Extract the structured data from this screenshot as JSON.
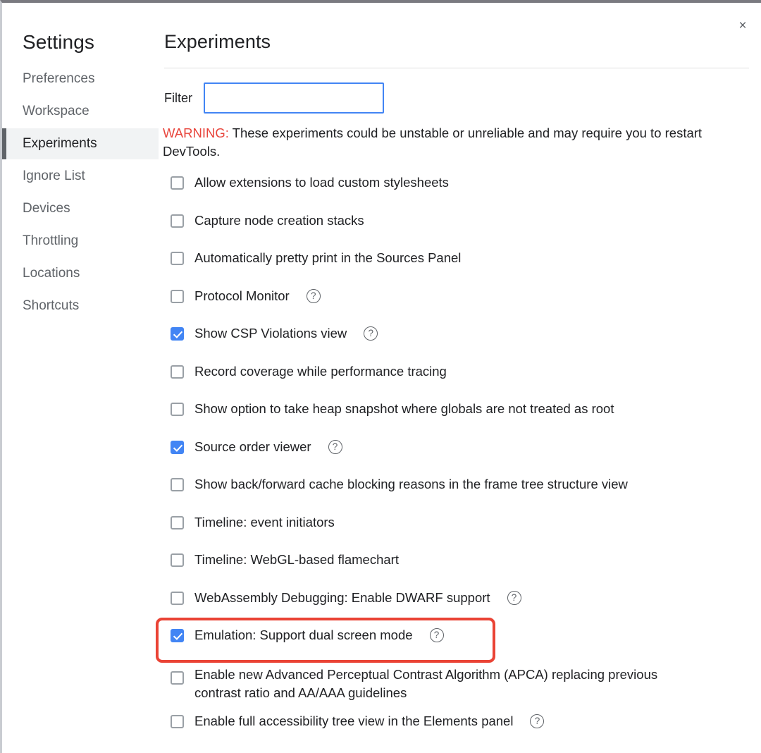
{
  "window": {
    "close_label": "×"
  },
  "sidebar": {
    "title": "Settings",
    "items": [
      {
        "label": "Preferences",
        "selected": false
      },
      {
        "label": "Workspace",
        "selected": false
      },
      {
        "label": "Experiments",
        "selected": true
      },
      {
        "label": "Ignore List",
        "selected": false
      },
      {
        "label": "Devices",
        "selected": false
      },
      {
        "label": "Throttling",
        "selected": false
      },
      {
        "label": "Locations",
        "selected": false
      },
      {
        "label": "Shortcuts",
        "selected": false
      }
    ]
  },
  "content": {
    "title": "Experiments",
    "filter": {
      "label": "Filter",
      "value": "",
      "placeholder": ""
    },
    "warning": {
      "tag": "WARNING:",
      "text": " These experiments could be unstable or unreliable and may require you to restart DevTools."
    },
    "experiments": [
      {
        "label": "Allow extensions to load custom stylesheets",
        "checked": false,
        "help": false
      },
      {
        "label": "Capture node creation stacks",
        "checked": false,
        "help": false
      },
      {
        "label": "Automatically pretty print in the Sources Panel",
        "checked": false,
        "help": false
      },
      {
        "label": "Protocol Monitor",
        "checked": false,
        "help": true
      },
      {
        "label": "Show CSP Violations view",
        "checked": true,
        "help": true
      },
      {
        "label": "Record coverage while performance tracing",
        "checked": false,
        "help": false
      },
      {
        "label": "Show option to take heap snapshot where globals are not treated as root",
        "checked": false,
        "help": false
      },
      {
        "label": "Source order viewer",
        "checked": true,
        "help": true
      },
      {
        "label": "Show back/forward cache blocking reasons in the frame tree structure view",
        "checked": false,
        "help": false
      },
      {
        "label": "Timeline: event initiators",
        "checked": false,
        "help": false
      },
      {
        "label": "Timeline: WebGL-based flamechart",
        "checked": false,
        "help": false
      },
      {
        "label": "WebAssembly Debugging: Enable DWARF support",
        "checked": false,
        "help": true
      },
      {
        "label": "Emulation: Support dual screen mode",
        "checked": true,
        "help": true,
        "highlighted": true
      },
      {
        "label": "Enable new Advanced Perceptual Contrast Algorithm (APCA) replacing previous contrast ratio and AA/AAA guidelines",
        "checked": false,
        "help": true,
        "help_far": true,
        "tall": true
      },
      {
        "label": "Enable full accessibility tree view in the Elements panel",
        "checked": false,
        "help": true
      }
    ],
    "help_icon_glyph": "?"
  },
  "colors": {
    "accent_blue": "#4285f4",
    "warning_red": "#e8453c",
    "annotation_red": "#ea4335",
    "text_primary": "#202124",
    "text_secondary": "#5f6368",
    "selected_bg": "#f1f3f4"
  }
}
